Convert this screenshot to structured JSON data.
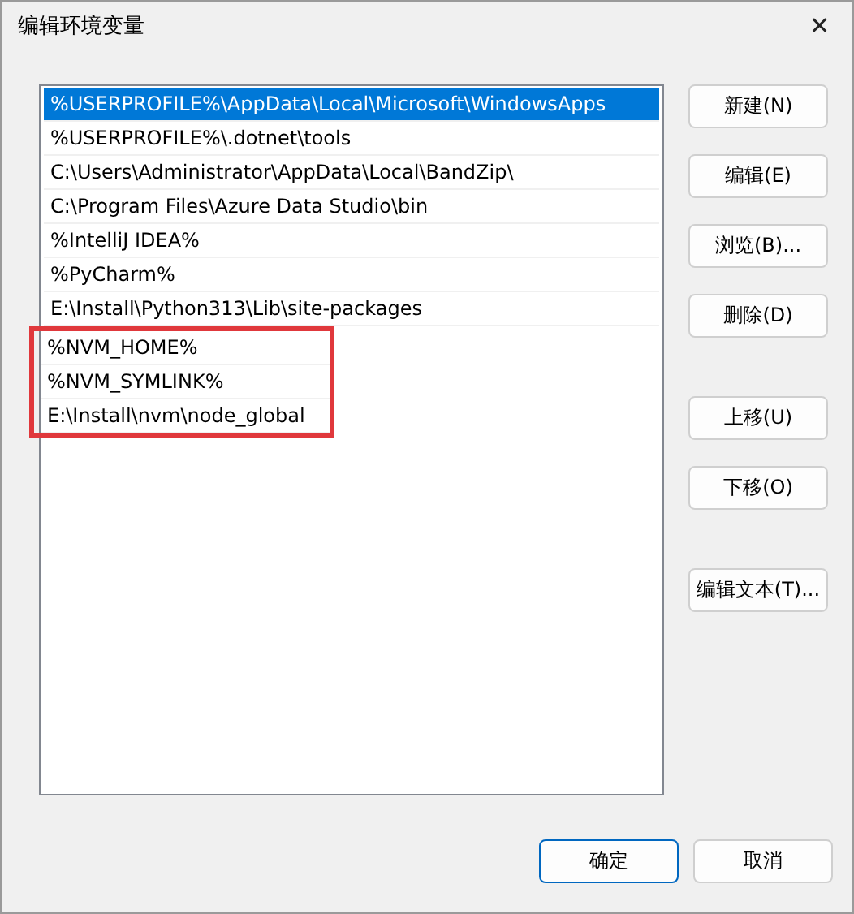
{
  "window": {
    "title": "编辑环境变量",
    "close": "✕"
  },
  "paths": [
    {
      "text": "%USERPROFILE%\\AppData\\Local\\Microsoft\\WindowsApps",
      "selected": true,
      "outlined": false
    },
    {
      "text": "%USERPROFILE%\\.dotnet\\tools",
      "selected": false,
      "outlined": false
    },
    {
      "text": "C:\\Users\\Administrator\\AppData\\Local\\BandZip\\",
      "selected": false,
      "outlined": false
    },
    {
      "text": "C:\\Program Files\\Azure Data Studio\\bin",
      "selected": false,
      "outlined": false
    },
    {
      "text": "%IntelliJ IDEA%",
      "selected": false,
      "outlined": false
    },
    {
      "text": "%PyCharm%",
      "selected": false,
      "outlined": false
    },
    {
      "text": "E:\\Install\\Python313\\Lib\\site-packages",
      "selected": false,
      "outlined": false
    },
    {
      "text": "%NVM_HOME%",
      "selected": false,
      "outlined": true
    },
    {
      "text": "%NVM_SYMLINK%",
      "selected": false,
      "outlined": true
    },
    {
      "text": "E:\\Install\\nvm\\node_global",
      "selected": false,
      "outlined": true
    }
  ],
  "side_button_groups": [
    [
      "新建(N)",
      "编辑(E)",
      "浏览(B)...",
      "删除(D)"
    ],
    [
      "上移(U)",
      "下移(O)"
    ],
    [
      "编辑文本(T)..."
    ]
  ],
  "footer_buttons": [
    {
      "label": "确定",
      "default": true
    },
    {
      "label": "取消",
      "default": false
    }
  ]
}
